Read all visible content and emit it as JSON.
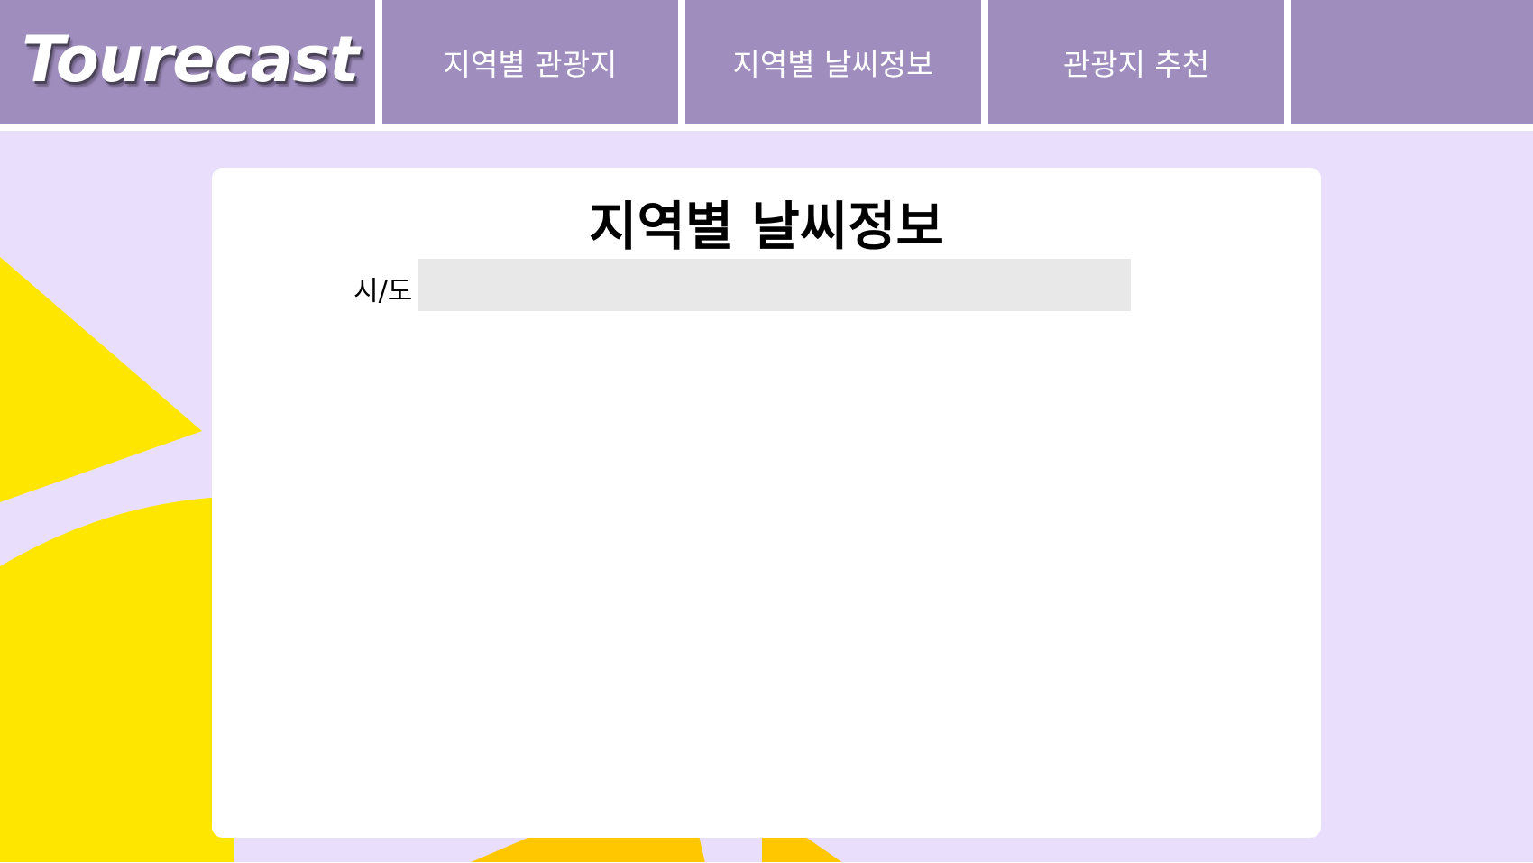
{
  "brand": {
    "logo_text": "Tourecast"
  },
  "nav": {
    "items": [
      {
        "label": "지역별 관광지"
      },
      {
        "label": "지역별 날씨정보"
      },
      {
        "label": "관광지 추천"
      },
      {
        "label": ""
      }
    ]
  },
  "main": {
    "title": "지역별 날씨정보",
    "region_label": "시/도",
    "region_value": ""
  },
  "colors": {
    "nav_bg": "#9f8ebd",
    "page_bg": "#e9dffd",
    "accent_yellow": "#ffe600",
    "accent_orange": "#ffc700",
    "select_bg": "#e8e8e8"
  }
}
